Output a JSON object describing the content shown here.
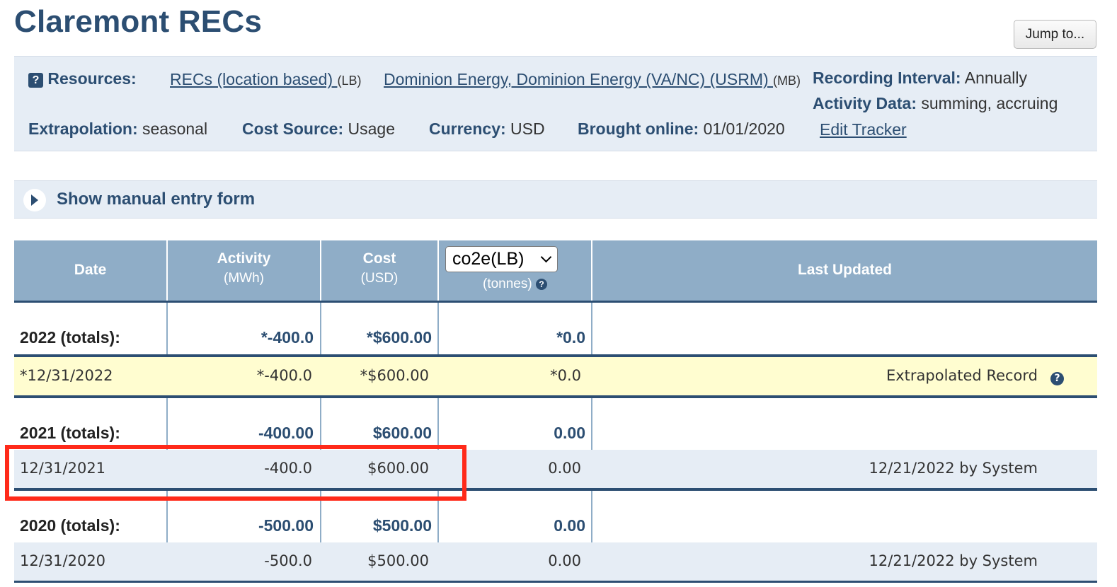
{
  "page_title": "Claremont RECs",
  "jump_button": "Jump to...",
  "info": {
    "resources_label": "Resources:",
    "resource1_link": "RECs (location based) ",
    "resource1_tag": "(LB)",
    "resource2_link": "Dominion Energy, Dominion Energy (VA/NC) (USRM) ",
    "resource2_tag": "(MB)",
    "recording_interval_label": "Recording Interval:",
    "recording_interval_value": "Annually",
    "activity_data_label": "Activity Data:",
    "activity_data_value": "summing, accruing",
    "extrapolation_label": "Extrapolation:",
    "extrapolation_value": "seasonal",
    "cost_source_label": "Cost Source:",
    "cost_source_value": "Usage",
    "currency_label": "Currency:",
    "currency_value": "USD",
    "brought_online_label": "Brought online:",
    "brought_online_value": "01/01/2020",
    "edit_tracker": "Edit Tracker"
  },
  "manual_entry": "Show manual entry form",
  "table": {
    "headers": {
      "date": "Date",
      "activity": "Activity",
      "activity_unit": "(MWh)",
      "cost": "Cost",
      "cost_unit": "(USD)",
      "emission_select": "co2e(LB)",
      "emission_unit": "(tonnes)",
      "last_updated": "Last Updated"
    },
    "groups": [
      {
        "total": {
          "label": "2022 (totals):",
          "activity": "*-400.0",
          "cost": "*$600.00",
          "emission": "*0.0"
        },
        "record": {
          "date": "*12/31/2022",
          "activity": "*-400.0",
          "cost": "*$600.00",
          "emission": "*0.0",
          "last_updated": "Extrapolated Record"
        }
      },
      {
        "total": {
          "label": "2021 (totals):",
          "activity": "-400.00",
          "cost": "$600.00",
          "emission": "0.00"
        },
        "record": {
          "date": "12/31/2021",
          "activity": "-400.0",
          "cost": "$600.00",
          "emission": "0.00",
          "last_updated": "12/21/2022 by System"
        }
      },
      {
        "total": {
          "label": "2020 (totals):",
          "activity": "-500.00",
          "cost": "$500.00",
          "emission": "0.00"
        },
        "record": {
          "date": "12/31/2020",
          "activity": "-500.0",
          "cost": "$500.00",
          "emission": "0.00",
          "last_updated": "12/21/2022 by System"
        }
      }
    ]
  },
  "colors": {
    "brand_blue": "#2c4e72",
    "header_bg": "#8fadc7",
    "panel_bg": "#e6edf5",
    "extrapolated_bg": "#fffdd0",
    "highlight_red": "#ff2a1a"
  }
}
